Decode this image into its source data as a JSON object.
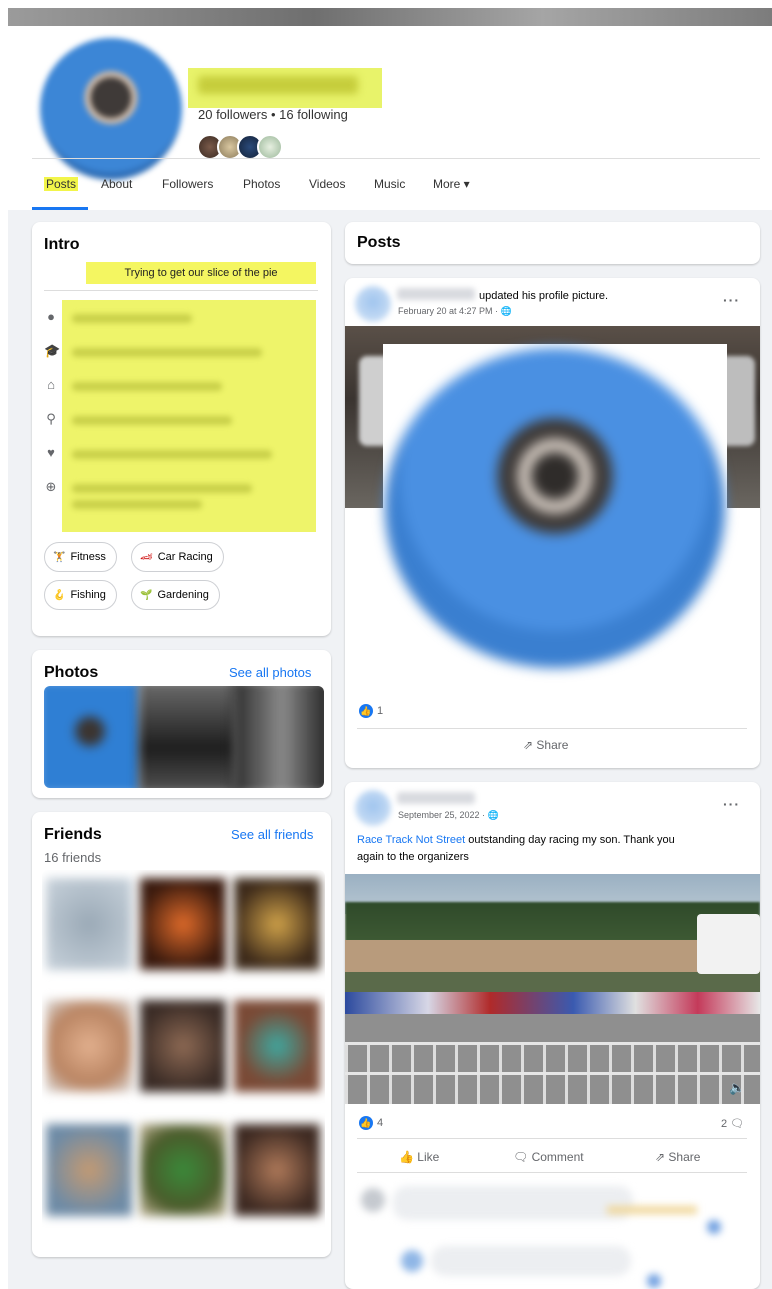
{
  "profile": {
    "follow_counts": "20 followers • 16 following"
  },
  "nav": {
    "tabs": [
      "Posts",
      "About",
      "Followers",
      "Photos",
      "Videos",
      "Music",
      "More ▾"
    ],
    "active_tab": "Posts"
  },
  "intro": {
    "title": "Intro",
    "bio": "Trying to get our slice of the pie",
    "hobbies": [
      {
        "label": "Fitness",
        "icon": "dumbbell-icon"
      },
      {
        "label": "Car Racing",
        "icon": "race-car-icon"
      },
      {
        "label": "Fishing",
        "icon": "fishing-hook-icon"
      },
      {
        "label": "Gardening",
        "icon": "sprout-icon"
      }
    ]
  },
  "photos": {
    "title": "Photos",
    "link": "See all photos"
  },
  "friends": {
    "title": "Friends",
    "link": "See all friends",
    "count": "16 friends"
  },
  "posts_header": {
    "title": "Posts"
  },
  "post1": {
    "action_text": "updated his profile picture.",
    "timestamp": "February 20 at 4:27 PM · 🌐",
    "menu": "···",
    "reactions": "1",
    "share_label": "Share"
  },
  "post2": {
    "timestamp": "September 25, 2022 · 🌐",
    "menu": "···",
    "link_text": "Race Track Not Street",
    "text_line1": " outstanding day racing my son.  Thank you",
    "text_line2": "again to the organizers",
    "reactions": "4",
    "comments": "2",
    "like_label": "Like",
    "comment_label": "Comment",
    "share_label": "Share"
  },
  "colors": {
    "accent": "#1877f2",
    "highlight": "#f2f54a",
    "page_bg": "#f0f2f5"
  }
}
